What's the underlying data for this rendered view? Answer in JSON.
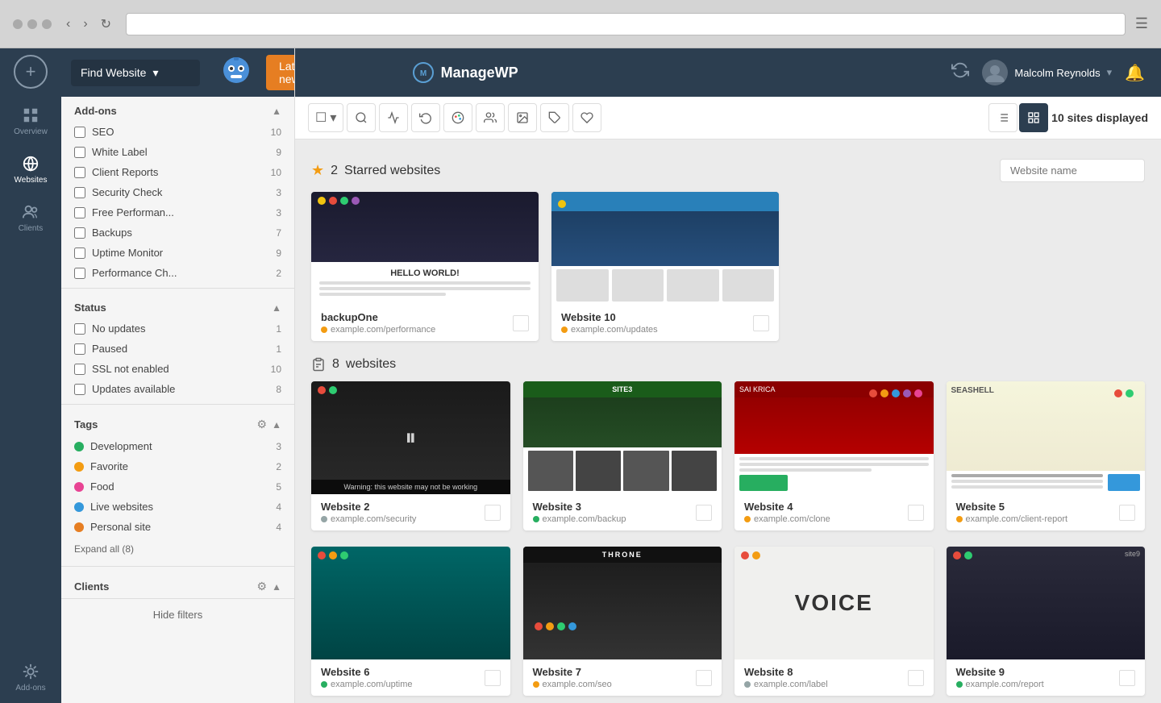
{
  "browser": {
    "dots": [
      "#fc5c65",
      "#ffd32a",
      "#0be881"
    ],
    "url_placeholder": ""
  },
  "header": {
    "find_website": "Find Website",
    "latest_news": "Latest news",
    "brand": "ManageWP",
    "user_name": "Malcolm Reynolds",
    "refresh_title": "Refresh"
  },
  "sidebar_icons": [
    {
      "id": "add",
      "label": "",
      "icon": "+"
    },
    {
      "id": "overview",
      "label": "Overview"
    },
    {
      "id": "websites",
      "label": "Websites",
      "active": true
    },
    {
      "id": "clients",
      "label": "Clients"
    },
    {
      "id": "addons",
      "label": "Add-ons"
    }
  ],
  "filter": {
    "title": "Find Website",
    "addons_label": "Add-ons",
    "addons": [
      {
        "label": "SEO",
        "count": 10
      },
      {
        "label": "White Label",
        "count": 9
      },
      {
        "label": "Client Reports",
        "count": 10
      },
      {
        "label": "Security Check",
        "count": 3
      },
      {
        "label": "Free Performan...",
        "count": 3
      },
      {
        "label": "Backups",
        "count": 7
      },
      {
        "label": "Uptime Monitor",
        "count": 9
      },
      {
        "label": "Performance Ch...",
        "count": 2
      }
    ],
    "status_label": "Status",
    "statuses": [
      {
        "label": "No updates",
        "count": 1
      },
      {
        "label": "Paused",
        "count": 1
      },
      {
        "label": "SSL not enabled",
        "count": 10
      },
      {
        "label": "Updates available",
        "count": 8
      }
    ],
    "tags_label": "Tags",
    "tags": [
      {
        "label": "Development",
        "count": 3,
        "color": "#27ae60"
      },
      {
        "label": "Favorite",
        "count": 2,
        "color": "#f39c12"
      },
      {
        "label": "Food",
        "count": 5,
        "color": "#e84393"
      },
      {
        "label": "Live websites",
        "count": 4,
        "color": "#3498db"
      },
      {
        "label": "Personal site",
        "count": 4,
        "color": "#e67e22"
      }
    ],
    "expand_all": "Expand all (8)",
    "clients_label": "Clients",
    "hide_filters": "Hide filters"
  },
  "toolbar": {
    "sites_count_label": "10 sites",
    "sites_count_suffix": " displayed",
    "search_placeholder": "Website name"
  },
  "starred_section": {
    "count": 2,
    "label": "Starred websites"
  },
  "websites_section": {
    "count": 8,
    "label": "websites"
  },
  "starred_websites": [
    {
      "id": "backupone",
      "name": "backupOne",
      "url": "example.com/performance",
      "status": "yellow",
      "thumb_class": "thumb-backupone"
    },
    {
      "id": "website10",
      "name": "Website 10",
      "url": "example.com/updates",
      "status": "yellow",
      "thumb_class": "thumb-website10"
    }
  ],
  "main_websites": [
    {
      "id": "website2",
      "name": "Website 2",
      "url": "example.com/security",
      "status": "gray",
      "thumb_class": "thumb-website2",
      "paused": true
    },
    {
      "id": "website3",
      "name": "Website 3",
      "url": "example.com/backup",
      "status": "green",
      "thumb_class": "thumb-website3"
    },
    {
      "id": "website4",
      "name": "Website 4",
      "url": "example.com/clone",
      "status": "yellow",
      "thumb_class": "thumb-website4"
    },
    {
      "id": "website5",
      "name": "Website 5",
      "url": "example.com/client-report",
      "status": "yellow",
      "thumb_class": "thumb-website5"
    }
  ],
  "bottom_websites": [
    {
      "id": "website6",
      "name": "Website 6",
      "url": "example.com/uptime",
      "status": "green",
      "thumb_class": "thumb-bottom1"
    },
    {
      "id": "website7",
      "name": "Website 7",
      "url": "example.com/seo",
      "status": "yellow",
      "thumb_class": "thumb-bottom2"
    },
    {
      "id": "website8",
      "name": "Website 8",
      "url": "example.com/label",
      "status": "gray",
      "thumb_class": "thumb-bottom3"
    },
    {
      "id": "website9",
      "name": "Website 9",
      "url": "example.com/report",
      "status": "green",
      "thumb_class": "thumb-bottom4"
    }
  ],
  "icons": {
    "chevron_down": "▾",
    "star": "★",
    "search": "🔍",
    "analytics": "📊",
    "brush": "🖌",
    "color": "🎨",
    "user": "👤",
    "image": "🖼",
    "tag": "🏷",
    "plugin": "🔧",
    "list_view": "☰",
    "grid_view": "⊞"
  }
}
